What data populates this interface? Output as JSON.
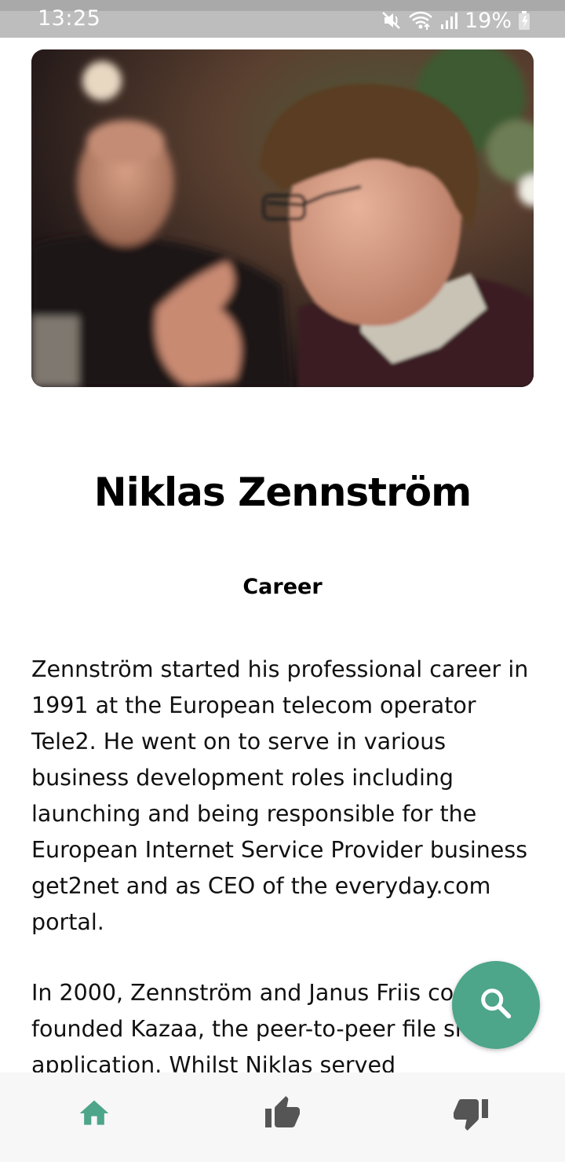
{
  "status_bar": {
    "time": "13:25",
    "battery_percent": "19%",
    "icons": [
      "mute-icon",
      "wifi-icon",
      "signal-icon",
      "battery-charging-icon"
    ]
  },
  "profile": {
    "name": "Niklas Zennström",
    "section_title": "Career",
    "paragraphs": [
      "Zennström started his professional career in 1991 at the European telecom operator Tele2. He went on to serve in various business development roles including launching and being responsible for the European Internet Service Provider business get2net and as CEO of the everyday.com portal.",
      "In 2000, Zennström and Janus Friis co-founded Kazaa, the peer-to-peer file sharing application. Whilst Niklas served"
    ]
  },
  "fab": {
    "icon": "search-icon",
    "color": "#4da58a"
  },
  "bottom_nav": {
    "items": [
      {
        "icon": "home-icon",
        "active": true
      },
      {
        "icon": "thumbs-up-icon",
        "active": false
      },
      {
        "icon": "thumbs-down-icon",
        "active": false
      }
    ],
    "active_color": "#4da58a",
    "inactive_color": "#555555"
  }
}
